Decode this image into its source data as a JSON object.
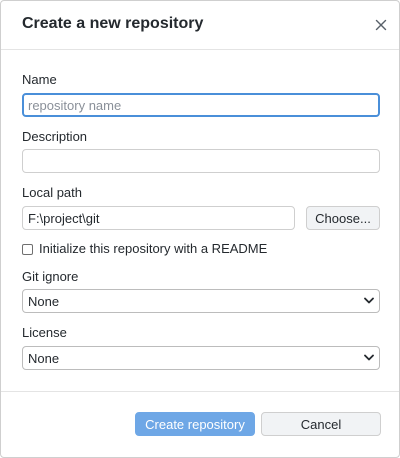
{
  "dialog": {
    "title": "Create a new repository",
    "close_icon": "close-icon"
  },
  "form": {
    "name": {
      "label": "Name",
      "value": "",
      "placeholder": "repository name"
    },
    "description": {
      "label": "Description",
      "value": "",
      "placeholder": ""
    },
    "local_path": {
      "label": "Local path",
      "value": "F:\\project\\git",
      "choose_label": "Choose..."
    },
    "readme": {
      "label": "Initialize this repository with a README",
      "checked": false
    },
    "git_ignore": {
      "label": "Git ignore",
      "selected": "None"
    },
    "license": {
      "label": "License",
      "selected": "None"
    }
  },
  "footer": {
    "create_label": "Create repository",
    "cancel_label": "Cancel"
  },
  "colors": {
    "primary_button": "#6ea7e6",
    "focus_ring": "#4a8fd9"
  }
}
